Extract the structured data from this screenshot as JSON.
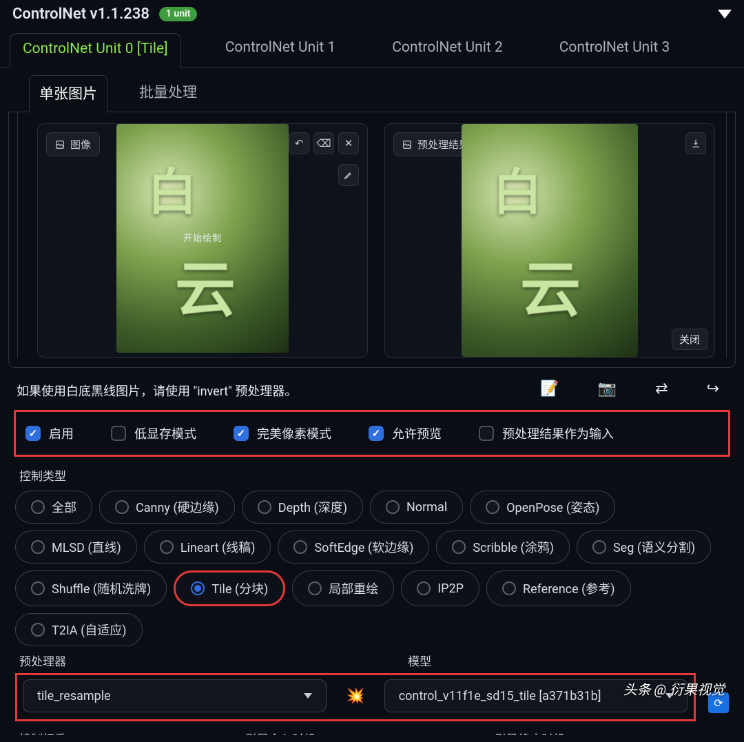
{
  "header": {
    "title": "ControlNet v1.1.238",
    "badge": "1 unit"
  },
  "unitTabs": [
    "ControlNet Unit 0 [Tile]",
    "ControlNet Unit 1",
    "ControlNet Unit 2",
    "ControlNet Unit 3"
  ],
  "subTabs": [
    "单张图片",
    "批量处理"
  ],
  "imagePanels": {
    "left": {
      "label": "图像",
      "overlay": "开始绘制"
    },
    "right": {
      "label": "预处理结果预览",
      "close": "关闭"
    }
  },
  "hintText": "如果使用白底黑线图片，请使用 \"invert\" 预处理器。",
  "actionIcons": [
    "📝",
    "📷",
    "⇄",
    "↪"
  ],
  "checkboxes": [
    {
      "label": "启用",
      "checked": true
    },
    {
      "label": "低显存模式",
      "checked": false
    },
    {
      "label": "完美像素模式",
      "checked": true
    },
    {
      "label": "允许预览",
      "checked": true
    },
    {
      "label": "预处理结果作为输入",
      "checked": false
    }
  ],
  "controlTypeLabel": "控制类型",
  "controlTypes": [
    "全部",
    "Canny (硬边缘)",
    "Depth (深度)",
    "Normal",
    "OpenPose (姿态)",
    "MLSD (直线)",
    "Lineart (线稿)",
    "SoftEdge (软边缘)",
    "Scribble (涂鸦)",
    "Seg (语义分割)",
    "Shuffle (随机洗牌)",
    "Tile (分块)",
    "局部重绘",
    "IP2P",
    "Reference (参考)",
    "T2IA (自适应)"
  ],
  "controlTypeSelected": "Tile (分块)",
  "preprocessor": {
    "label": "预处理器",
    "value": "tile_resample"
  },
  "model": {
    "label": "模型",
    "value": "control_v11f1e_sd15_tile [a371b31b]"
  },
  "bottomCut": [
    "控制权重",
    "引导介入时机",
    "引导终止时机"
  ],
  "watermark": "头条 @ 衍果视觉"
}
